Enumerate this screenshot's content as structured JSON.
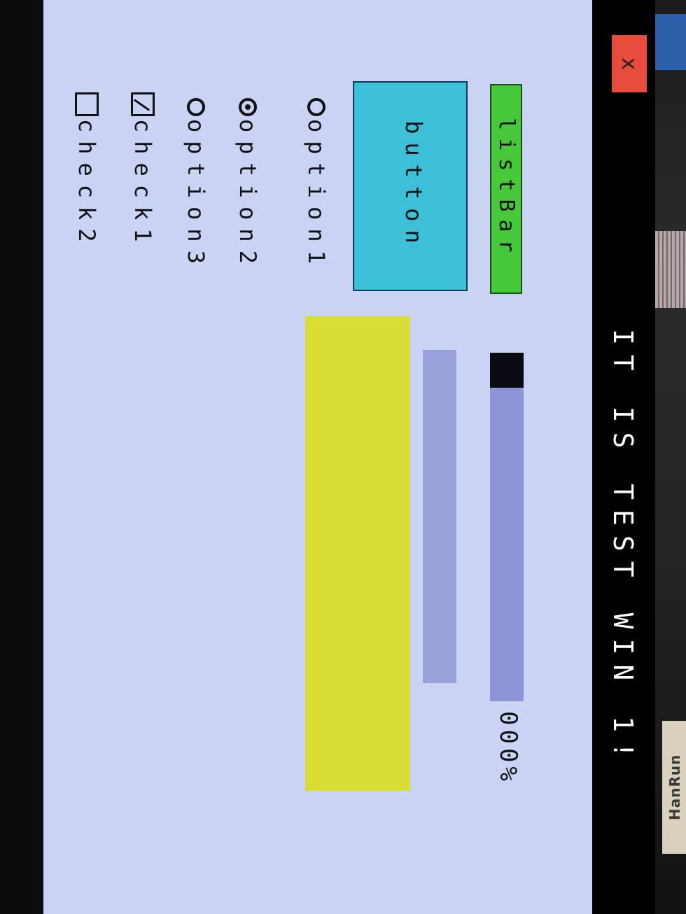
{
  "window": {
    "title": "IT IS TEST WIN 1!",
    "close_glyph": "x"
  },
  "listbar": {
    "label": "listBar"
  },
  "button": {
    "label": "button"
  },
  "radios": [
    {
      "label": "option1",
      "checked": false
    },
    {
      "label": "option2",
      "checked": true
    },
    {
      "label": "option3",
      "checked": false
    }
  ],
  "checkboxes": [
    {
      "label": "check1",
      "checked": true
    },
    {
      "label": "check2",
      "checked": false
    }
  ],
  "progress": {
    "value_percent": 0,
    "label": "000%"
  },
  "slider": {
    "value_percent": 0
  },
  "board": {
    "chip_label": "HanRun"
  },
  "colors": {
    "screen_bg": "#cbd3f4",
    "titlebar": "#000000",
    "close_button": "#e84c3d",
    "listbar": "#47c83a",
    "button": "#3cc0d8",
    "progress_track": "#8e94d6",
    "progress_fill": "#0a0a12",
    "yellow_area": "#d8dc33"
  }
}
